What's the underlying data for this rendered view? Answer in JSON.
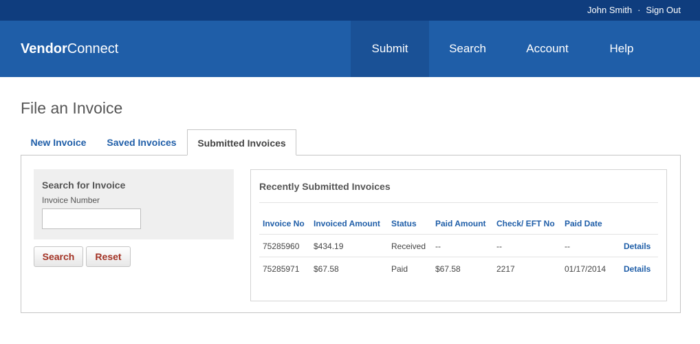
{
  "topbar": {
    "user_name": "John Smith",
    "separator": "·",
    "sign_out": "Sign Out"
  },
  "brand": {
    "bold": "Vendor",
    "light": "Connect"
  },
  "nav": {
    "items": [
      "Submit",
      "Search",
      "Account",
      "Help"
    ],
    "active": "Submit"
  },
  "page": {
    "title": "File an Invoice"
  },
  "tabs": {
    "items": [
      "New Invoice",
      "Saved Invoices",
      "Submitted Invoices"
    ],
    "active": "Submitted Invoices"
  },
  "search": {
    "heading": "Search for Invoice",
    "field_label": "Invoice Number",
    "field_value": "",
    "search_label": "Search",
    "reset_label": "Reset"
  },
  "recent": {
    "heading": "Recently Submitted Invoices",
    "columns": [
      "Invoice No",
      "Invoiced Amount",
      "Status",
      "Paid Amount",
      "Check/ EFT No",
      "Paid Date"
    ],
    "rows": [
      {
        "invoice_no": "75285960",
        "invoiced_amount": "$434.19",
        "status": "Received",
        "paid_amount": "--",
        "check_eft_no": "--",
        "paid_date": "--",
        "action": "Details"
      },
      {
        "invoice_no": "75285971",
        "invoiced_amount": "$67.58",
        "status": "Paid",
        "paid_amount": "$67.58",
        "check_eft_no": "2217",
        "paid_date": "01/17/2014",
        "action": "Details"
      }
    ]
  },
  "colors": {
    "topbar": "#0f3d7e",
    "navbar": "#1f5ea8",
    "nav_active": "#1a5196",
    "link": "#1f5ea8",
    "button_text": "#a33224"
  }
}
